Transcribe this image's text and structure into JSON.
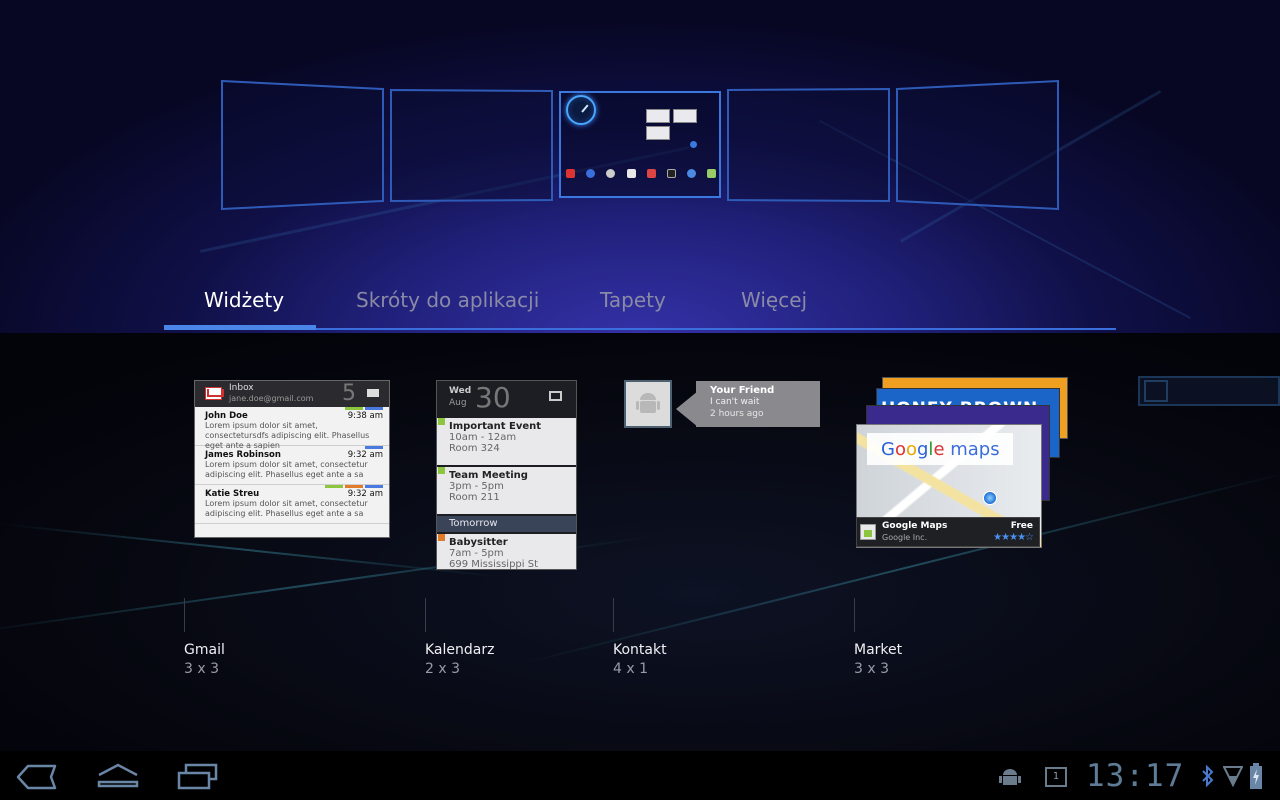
{
  "tabs": [
    {
      "label": "Widżety",
      "selected": true
    },
    {
      "label": "Skróty do aplikacji",
      "selected": false
    },
    {
      "label": "Tapety",
      "selected": false
    },
    {
      "label": "Więcej",
      "selected": false
    }
  ],
  "widgets": [
    {
      "name": "Gmail",
      "size": "3 x 3"
    },
    {
      "name": "Kalendarz",
      "size": "2 x 3"
    },
    {
      "name": "Kontakt",
      "size": "4 x 1"
    },
    {
      "name": "Market",
      "size": "3 x 3"
    }
  ],
  "gmail_preview": {
    "label": "Inbox",
    "account": "jane.doe@gmail.com",
    "unread": "5",
    "messages": [
      {
        "from": "John Doe",
        "time": "9:38 am",
        "snippet": "Lorem ipsum dolor sit amet, consectetursdfs adipiscing elit. Phasellus eget ante a sapien"
      },
      {
        "from": "James Robinson",
        "time": "9:32 am",
        "snippet": "Lorem ipsum dolor sit amet, consectetur adipiscing elit. Phasellus eget ante a sa"
      },
      {
        "from": "Katie Streu",
        "time": "9:32 am",
        "snippet": "Lorem ipsum dolor sit amet, consectetur adipiscing elit. Phasellus eget ante a sa"
      }
    ]
  },
  "calendar_preview": {
    "weekday": "Wed",
    "month": "Aug",
    "date": "30",
    "events": [
      {
        "title": "Important Event",
        "time": "10am - 12am",
        "place": "Room 324",
        "color": "#8cc63f"
      },
      {
        "title": "Team Meeting",
        "time": "3pm - 5pm",
        "place": "Room 211",
        "color": "#8cc63f"
      }
    ],
    "tomorrow_label": "Tomorrow",
    "tomorrow_event": {
      "title": "Babysitter",
      "time": "7am - 5pm",
      "place": "699 Mississippi St",
      "color": "#e07b2a"
    }
  },
  "contact_preview": {
    "name": "Your Friend",
    "status": "I can't wait",
    "ago": "2 hours ago"
  },
  "market_preview": {
    "banner_text": "HONEY BROWN",
    "logo_text": "Google maps",
    "app_name": "Google Maps",
    "developer": "Google Inc.",
    "price": "Free",
    "rating": "★★★★☆"
  },
  "status_bar": {
    "time": "13:17",
    "notification_count": "1"
  },
  "colors": {
    "accent": "#4a86e8",
    "tab_inactive": "#8a8aa6",
    "clock": "#5f7c96"
  }
}
